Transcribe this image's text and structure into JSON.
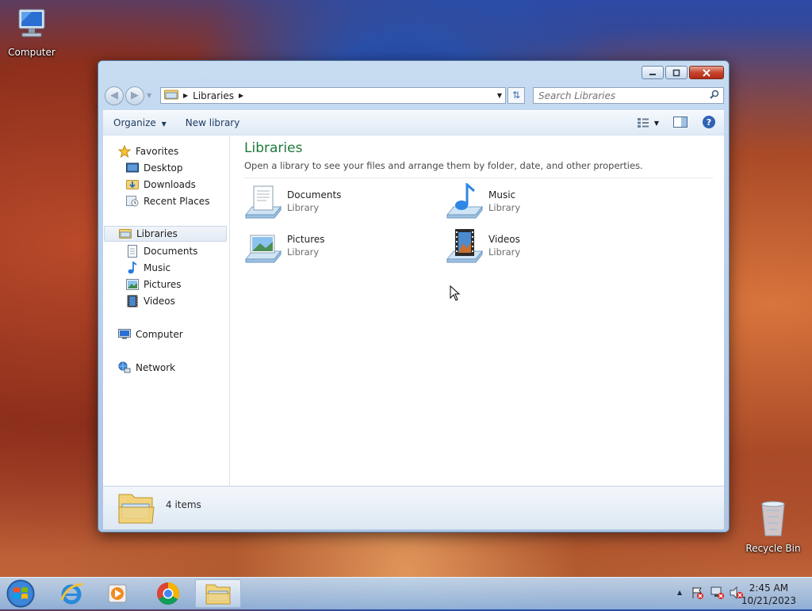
{
  "desktop": {
    "computer_label": "Computer",
    "recycle_label": "Recycle Bin"
  },
  "address": {
    "segment": "Libraries"
  },
  "search": {
    "placeholder": "Search Libraries"
  },
  "toolbar": {
    "organize": "Organize",
    "new_library": "New library"
  },
  "sidebar": {
    "favorites": "Favorites",
    "desktop": "Desktop",
    "downloads": "Downloads",
    "recent": "Recent Places",
    "libraries": "Libraries",
    "documents": "Documents",
    "music": "Music",
    "pictures": "Pictures",
    "videos": "Videos",
    "computer": "Computer",
    "network": "Network"
  },
  "main": {
    "title": "Libraries",
    "description": "Open a library to see your files and arrange them by folder, date, and other properties.",
    "libraries": [
      {
        "name": "Documents",
        "type": "Library"
      },
      {
        "name": "Music",
        "type": "Library"
      },
      {
        "name": "Pictures",
        "type": "Library"
      },
      {
        "name": "Videos",
        "type": "Library"
      }
    ]
  },
  "status": {
    "count": "4 items"
  },
  "clock": {
    "time": "2:45 AM",
    "date": "10/21/2023"
  }
}
